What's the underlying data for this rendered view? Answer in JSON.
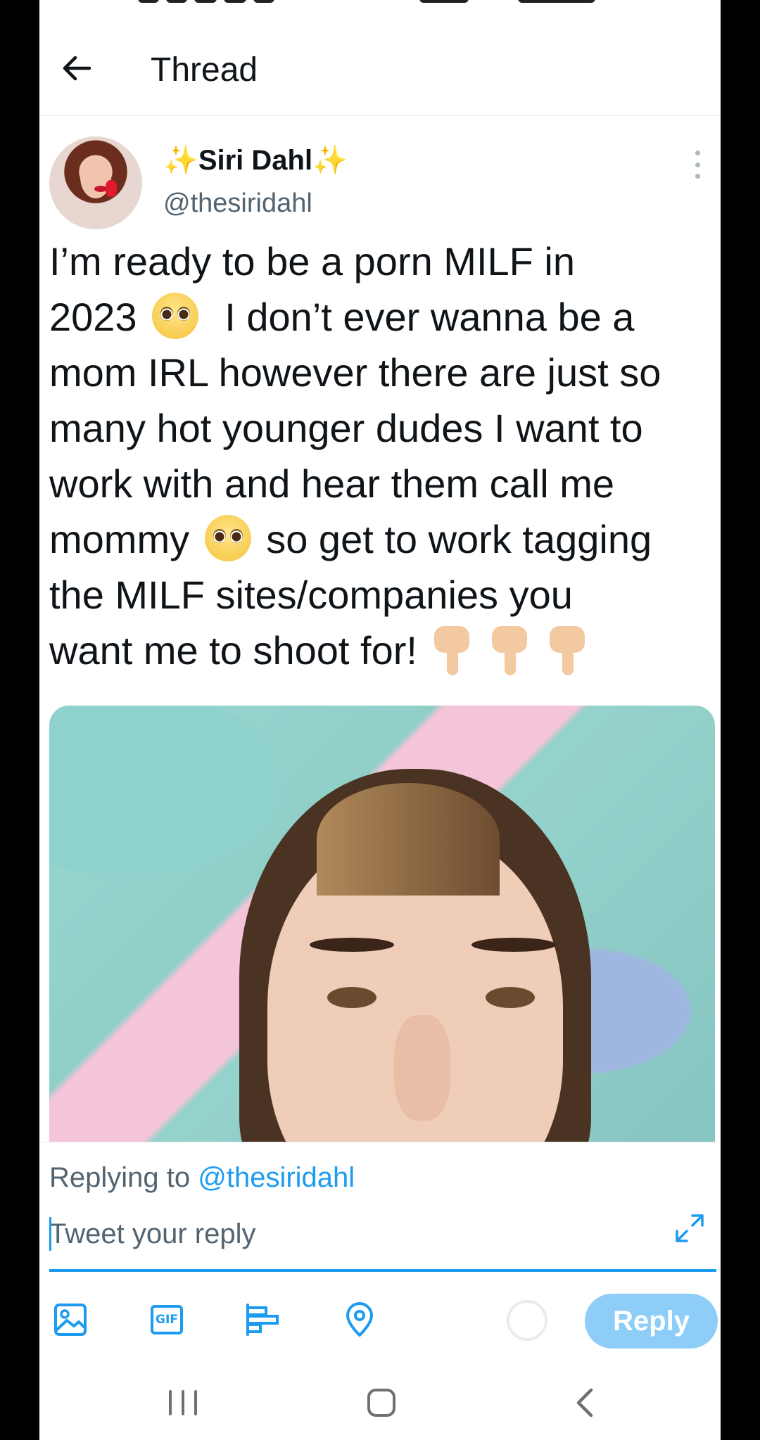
{
  "header": {
    "title": "Thread"
  },
  "tweet": {
    "display_name": "Siri Dahl",
    "sparkle_left": "✨",
    "sparkle_right": "✨",
    "handle": "@thesiridahl",
    "text_line_1": "I’m ready to be a porn MILF in",
    "text_line_2a": "2023",
    "text_line_2b": "I don’t ever wanna be a",
    "text_line_3": "mom IRL however there are just so",
    "text_line_4": "many hot younger dudes I want to",
    "text_line_5": "work with and hear them call me",
    "text_line_6a": "mommy",
    "text_line_6b": "so get to work tagging",
    "text_line_7": "the MILF sites/companies you",
    "text_line_8": "want me to shoot for!"
  },
  "composer": {
    "replying_prefix": "Replying to",
    "replying_mention": "@thesiridahl",
    "placeholder": "Tweet your reply",
    "gif_label": "GIF",
    "reply_label": "Reply"
  },
  "icons": {
    "back": "arrow-left-icon",
    "more": "more-vertical-icon",
    "expand": "expand-icon",
    "image": "image-icon",
    "gif": "gif-icon",
    "poll": "poll-icon",
    "location": "location-icon"
  },
  "colors": {
    "accent": "#1d9bf0",
    "reply_button_disabled": "#8ecdf8",
    "secondary_text": "#536471",
    "primary_text": "#0f1419"
  }
}
